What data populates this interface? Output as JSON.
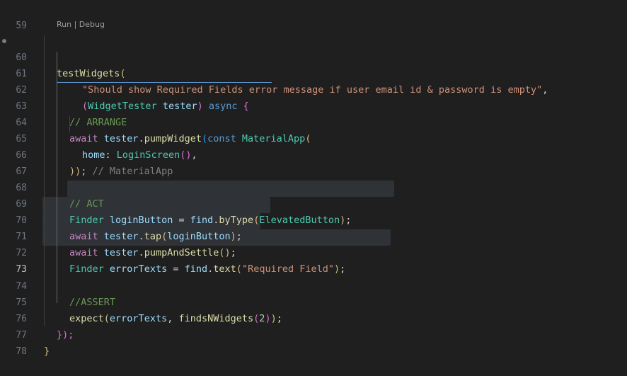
{
  "editor": {
    "codelens": "Run | Debug",
    "lines": [
      {
        "n": "59",
        "t": ""
      },
      {
        "n": "60",
        "t": ""
      },
      {
        "n": "61",
        "t": ""
      },
      {
        "n": "62",
        "t": ""
      },
      {
        "n": "63",
        "t": ""
      },
      {
        "n": "64",
        "t": ""
      },
      {
        "n": "65",
        "t": ""
      },
      {
        "n": "66",
        "t": ""
      },
      {
        "n": "67",
        "t": ""
      },
      {
        "n": "68",
        "t": ""
      },
      {
        "n": "69",
        "t": ""
      },
      {
        "n": "70",
        "t": ""
      },
      {
        "n": "71",
        "t": ""
      },
      {
        "n": "72",
        "t": ""
      },
      {
        "n": "73",
        "t": ""
      },
      {
        "n": "74",
        "t": ""
      },
      {
        "n": "75",
        "t": ""
      },
      {
        "n": "76",
        "t": ""
      },
      {
        "n": "77",
        "t": ""
      },
      {
        "n": "78",
        "t": ""
      }
    ],
    "tokens": {
      "testWidgets": "testWidgets",
      "open_paren": "(",
      "string61": "\"Should show Required Fields error message if user email id & password is empty\"",
      "comma": ",",
      "widgetTester": "WidgetTester",
      "tester": "tester",
      "async": "async",
      "brace_open": "{",
      "comment_arrange": "// ARRANGE",
      "await": "await",
      "pumpWidget": "pumpWidget",
      "const": "const",
      "materialApp": "MaterialApp",
      "home": "home",
      "colon": ":",
      "loginScreen": "LoginScreen",
      "parens": "()",
      "close66": "));",
      "comment66": "// MaterialApp",
      "comment_act": "// ACT",
      "finder": "Finder",
      "loginButton": "loginButton",
      "eq": "=",
      "find": "find",
      "byType": "byType",
      "elevatedButton": "ElevatedButton",
      "tap": "tap",
      "pumpAndSettle": "pumpAndSettle",
      "errorTexts": "errorTexts",
      "text": "text",
      "requiredField": "\"Required Field\"",
      "comment_assert": "//ASSERT",
      "expect": "expect",
      "findsNWidgets": "findsNWidgets",
      "two": "2",
      "close76": "});",
      "close77": "}"
    }
  },
  "colors": {
    "background": "#1f1f1f",
    "keyword": "#c586c0",
    "function": "#dcdcaa",
    "type": "#4ec9b0",
    "string": "#ce9178",
    "comment": "#6a9955"
  }
}
